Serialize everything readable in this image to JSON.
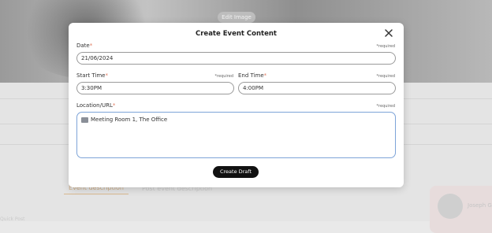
{
  "background": {
    "edit_image": "Edit Image",
    "tab_active": "Event description",
    "tab_inactive": "Post event description",
    "profile_name": "Joseph Go",
    "footer_text": "Quick Post"
  },
  "modal": {
    "title": "Create Event Content",
    "required_text": "*required",
    "date": {
      "label": "Date",
      "value": "21/06/2024"
    },
    "start_time": {
      "label": "Start Time",
      "value": "3:30PM"
    },
    "end_time": {
      "label": "End Time",
      "value": "4:00PM"
    },
    "location": {
      "label": "Location/URL",
      "value": "Meeting Room 1, The Office"
    },
    "create_button": "Create Draft"
  }
}
